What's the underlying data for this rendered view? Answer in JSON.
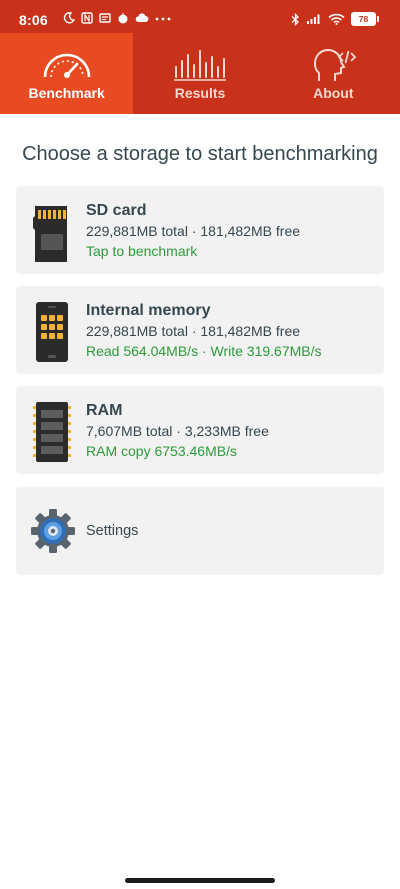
{
  "status_bar": {
    "time": "8:06",
    "battery": "78"
  },
  "tabs": [
    {
      "label": "Benchmark",
      "active": true,
      "icon": "speedometer-icon"
    },
    {
      "label": "Results",
      "active": false,
      "icon": "bars-icon"
    },
    {
      "label": "About",
      "active": false,
      "icon": "head-code-icon"
    }
  ],
  "page_title": "Choose a storage to start benchmarking",
  "storage_items": [
    {
      "title": "SD card",
      "subtitle": "229,881MB total · 181,482MB free",
      "status": "Tap to benchmark",
      "icon": "sd-card-icon"
    },
    {
      "title": "Internal memory",
      "subtitle": "229,881MB total · 181,482MB free",
      "status": "Read 564.04MB/s · Write 319.67MB/s",
      "icon": "phone-chip-icon"
    },
    {
      "title": "RAM",
      "subtitle": "7,607MB total · 3,233MB free",
      "status": "RAM copy 6753.46MB/s",
      "icon": "ram-chip-icon"
    }
  ],
  "settings": {
    "label": "Settings",
    "icon": "gear-icon"
  },
  "colors": {
    "header": "#c9321a",
    "active_tab": "#e84b22",
    "status_green": "#2e9a3a",
    "text": "#37474f",
    "card_bg": "#f2f2f2"
  }
}
